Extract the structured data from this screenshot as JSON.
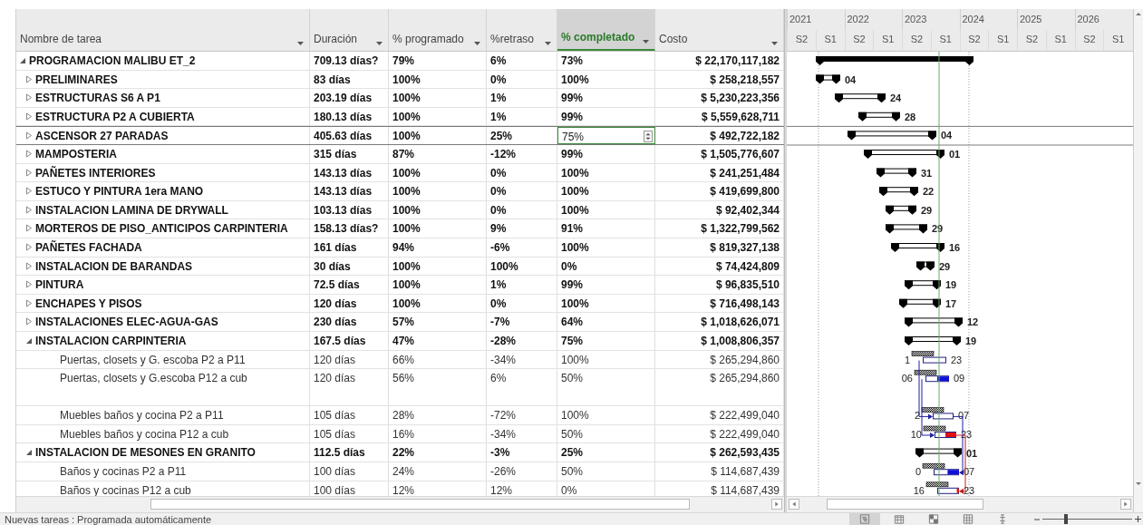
{
  "columns": [
    {
      "label": "Nombre de tarea",
      "selected": false
    },
    {
      "label": "Duración",
      "selected": false
    },
    {
      "label": "% programado",
      "selected": false
    },
    {
      "label": "%retraso",
      "selected": false
    },
    {
      "label": "% completado",
      "selected": true
    },
    {
      "label": "Costo",
      "selected": false
    }
  ],
  "timescale": {
    "years": [
      "2021",
      "2022",
      "2023",
      "2024",
      "2025",
      "2026"
    ],
    "halves": [
      "S2",
      "S1",
      "S2",
      "S1",
      "S2",
      "S1",
      "S2",
      "S1",
      "S2",
      "S1",
      "S2",
      "S1"
    ]
  },
  "tasks": [
    {
      "name": "PROGRAMACION MALIBU ET_2",
      "duration": "709.13 días?",
      "scheduled": "79%",
      "delay": "6%",
      "complete": "73%",
      "cost": "$ 22,170,117,182",
      "kind": "summary",
      "expanded": true,
      "selected": false,
      "children": [
        {
          "name": "PRELIMINARES",
          "duration": "83 días",
          "scheduled": "100%",
          "delay": "0%",
          "complete": "100%",
          "cost": "$ 258,218,557",
          "kind": "summary",
          "expanded": false,
          "selected": false,
          "finish_label": "04"
        },
        {
          "name": "ESTRUCTURAS S6 A P1",
          "duration": "203.19 días",
          "scheduled": "100%",
          "delay": "1%",
          "complete": "99%",
          "cost": "$ 5,230,223,356",
          "kind": "summary",
          "expanded": false,
          "selected": false,
          "finish_label": "24"
        },
        {
          "name": "ESTRUCTURA P2 A CUBIERTA",
          "duration": "180.13 días",
          "scheduled": "100%",
          "delay": "1%",
          "complete": "99%",
          "cost": "$ 5,559,628,711",
          "kind": "summary",
          "expanded": false,
          "selected": false,
          "finish_label": "28"
        },
        {
          "name": "ASCENSOR 27 PARADAS",
          "duration": "405.63 días",
          "scheduled": "100%",
          "delay": "25%",
          "complete": "75%",
          "cost": "$ 492,722,182",
          "kind": "summary",
          "expanded": false,
          "selected": true,
          "finish_label": "04"
        },
        {
          "name": "MAMPOSTERIA",
          "duration": "315 días",
          "scheduled": "87%",
          "delay": "-12%",
          "complete": "99%",
          "cost": "$ 1,505,776,607",
          "kind": "summary",
          "expanded": false,
          "selected": false,
          "finish_label": "01"
        },
        {
          "name": "PAÑETES INTERIORES",
          "duration": "143.13 días",
          "scheduled": "100%",
          "delay": "0%",
          "complete": "100%",
          "cost": "$ 241,251,484",
          "kind": "summary",
          "expanded": false,
          "selected": false,
          "finish_label": "31"
        },
        {
          "name": "ESTUCO Y PINTURA 1era MANO",
          "duration": "143.13 días",
          "scheduled": "100%",
          "delay": "0%",
          "complete": "100%",
          "cost": "$ 419,699,800",
          "kind": "summary",
          "expanded": false,
          "selected": false,
          "finish_label": "22"
        },
        {
          "name": "INSTALACION LAMINA DE DRYWALL",
          "duration": "103.13 días",
          "scheduled": "100%",
          "delay": "0%",
          "complete": "100%",
          "cost": "$ 92,402,344",
          "kind": "summary",
          "expanded": false,
          "selected": false,
          "finish_label": "29"
        },
        {
          "name": "MORTEROS DE PISO_ANTICIPOS CARPINTERIA",
          "duration": "158.13 días?",
          "scheduled": "100%",
          "delay": "9%",
          "complete": "91%",
          "cost": "$ 1,322,799,562",
          "kind": "summary",
          "expanded": false,
          "selected": false,
          "finish_label": "29"
        },
        {
          "name": "PAÑETES FACHADA",
          "duration": "161 días",
          "scheduled": "94%",
          "delay": "-6%",
          "complete": "100%",
          "cost": "$ 819,327,138",
          "kind": "summary",
          "expanded": false,
          "selected": false,
          "finish_label": "16"
        },
        {
          "name": "INSTALACION DE BARANDAS",
          "duration": "30 días",
          "scheduled": "100%",
          "delay": "100%",
          "complete": "0%",
          "cost": "$ 74,424,809",
          "kind": "summary",
          "expanded": false,
          "selected": false,
          "finish_label": "29"
        },
        {
          "name": "PINTURA",
          "duration": "72.5 días",
          "scheduled": "100%",
          "delay": "1%",
          "complete": "99%",
          "cost": "$ 96,835,510",
          "kind": "summary",
          "expanded": false,
          "selected": false,
          "finish_label": "19"
        },
        {
          "name": "ENCHAPES Y PISOS",
          "duration": "120 días",
          "scheduled": "100%",
          "delay": "0%",
          "complete": "100%",
          "cost": "$ 716,498,143",
          "kind": "summary",
          "expanded": false,
          "selected": false,
          "finish_label": "17"
        },
        {
          "name": "INSTALACIONES ELEC-AGUA-GAS",
          "duration": "230 días",
          "scheduled": "57%",
          "delay": "-7%",
          "complete": "64%",
          "cost": "$ 1,018,626,071",
          "kind": "summary",
          "expanded": false,
          "selected": false,
          "finish_label": "12"
        },
        {
          "name": "INSTALACION CARPINTERIA",
          "duration": "167.5 días",
          "scheduled": "47%",
          "delay": "-28%",
          "complete": "75%",
          "cost": "$ 1,008,806,357",
          "kind": "summary",
          "expanded": true,
          "selected": false,
          "finish_label": "19",
          "children": [
            {
              "name": "Puertas, closets y G. escoba P2 a P11",
              "duration": "120 días",
              "scheduled": "66%",
              "delay": "-34%",
              "complete": "100%",
              "cost": "$ 265,294,860",
              "kind": "task",
              "selected": false,
              "start_label": "1",
              "finish_label": "23"
            },
            {
              "name": "Puertas, closets y G.escoba P12 a cub",
              "duration": "120 días",
              "scheduled": "56%",
              "delay": "6%",
              "complete": "50%",
              "cost": "$ 265,294,860",
              "kind": "task",
              "selected": false,
              "start_label": "06",
              "finish_label": "09"
            },
            {
              "name": "Muebles baños y cocina P2 a P11",
              "duration": "105 días",
              "scheduled": "28%",
              "delay": "-72%",
              "complete": "100%",
              "cost": "$ 222,499,040",
              "kind": "task",
              "selected": false,
              "start_label": "2",
              "finish_label": "07"
            },
            {
              "name": "Muebles baños y cocina P12 a cub",
              "duration": "105 días",
              "scheduled": "16%",
              "delay": "-34%",
              "complete": "50%",
              "cost": "$ 222,499,040",
              "kind": "task",
              "selected": false,
              "start_label": "10",
              "finish_label": "23"
            }
          ]
        },
        {
          "name": "INSTALACION DE MESONES EN GRANITO",
          "duration": "112.5 días",
          "scheduled": "22%",
          "delay": "-3%",
          "complete": "25%",
          "cost": "$ 262,593,435",
          "kind": "summary",
          "expanded": true,
          "selected": false,
          "finish_label": "01",
          "children": [
            {
              "name": "Baños y cocinas P2 a P11",
              "duration": "100 días",
              "scheduled": "24%",
              "delay": "-26%",
              "complete": "50%",
              "cost": "$ 114,687,439",
              "kind": "task",
              "selected": false,
              "start_label": "0",
              "finish_label": "07"
            },
            {
              "name": "Baños y cocinas P12 a cub",
              "duration": "100 días",
              "scheduled": "12%",
              "delay": "12%",
              "complete": "0%",
              "cost": "$ 114,687,439",
              "kind": "task",
              "selected": false,
              "start_label": "16",
              "finish_label": "23"
            }
          ]
        }
      ]
    }
  ],
  "status_bar": {
    "text": "Nuevas tareas : Programada automáticamente",
    "views": [
      {
        "kind": "gantt",
        "selected": true
      },
      {
        "kind": "calendar",
        "selected": false
      },
      {
        "kind": "network",
        "selected": false
      },
      {
        "kind": "sheet",
        "selected": false
      },
      {
        "kind": "timeline",
        "selected": false
      }
    ],
    "zoom": {
      "level": 0.26
    }
  }
}
